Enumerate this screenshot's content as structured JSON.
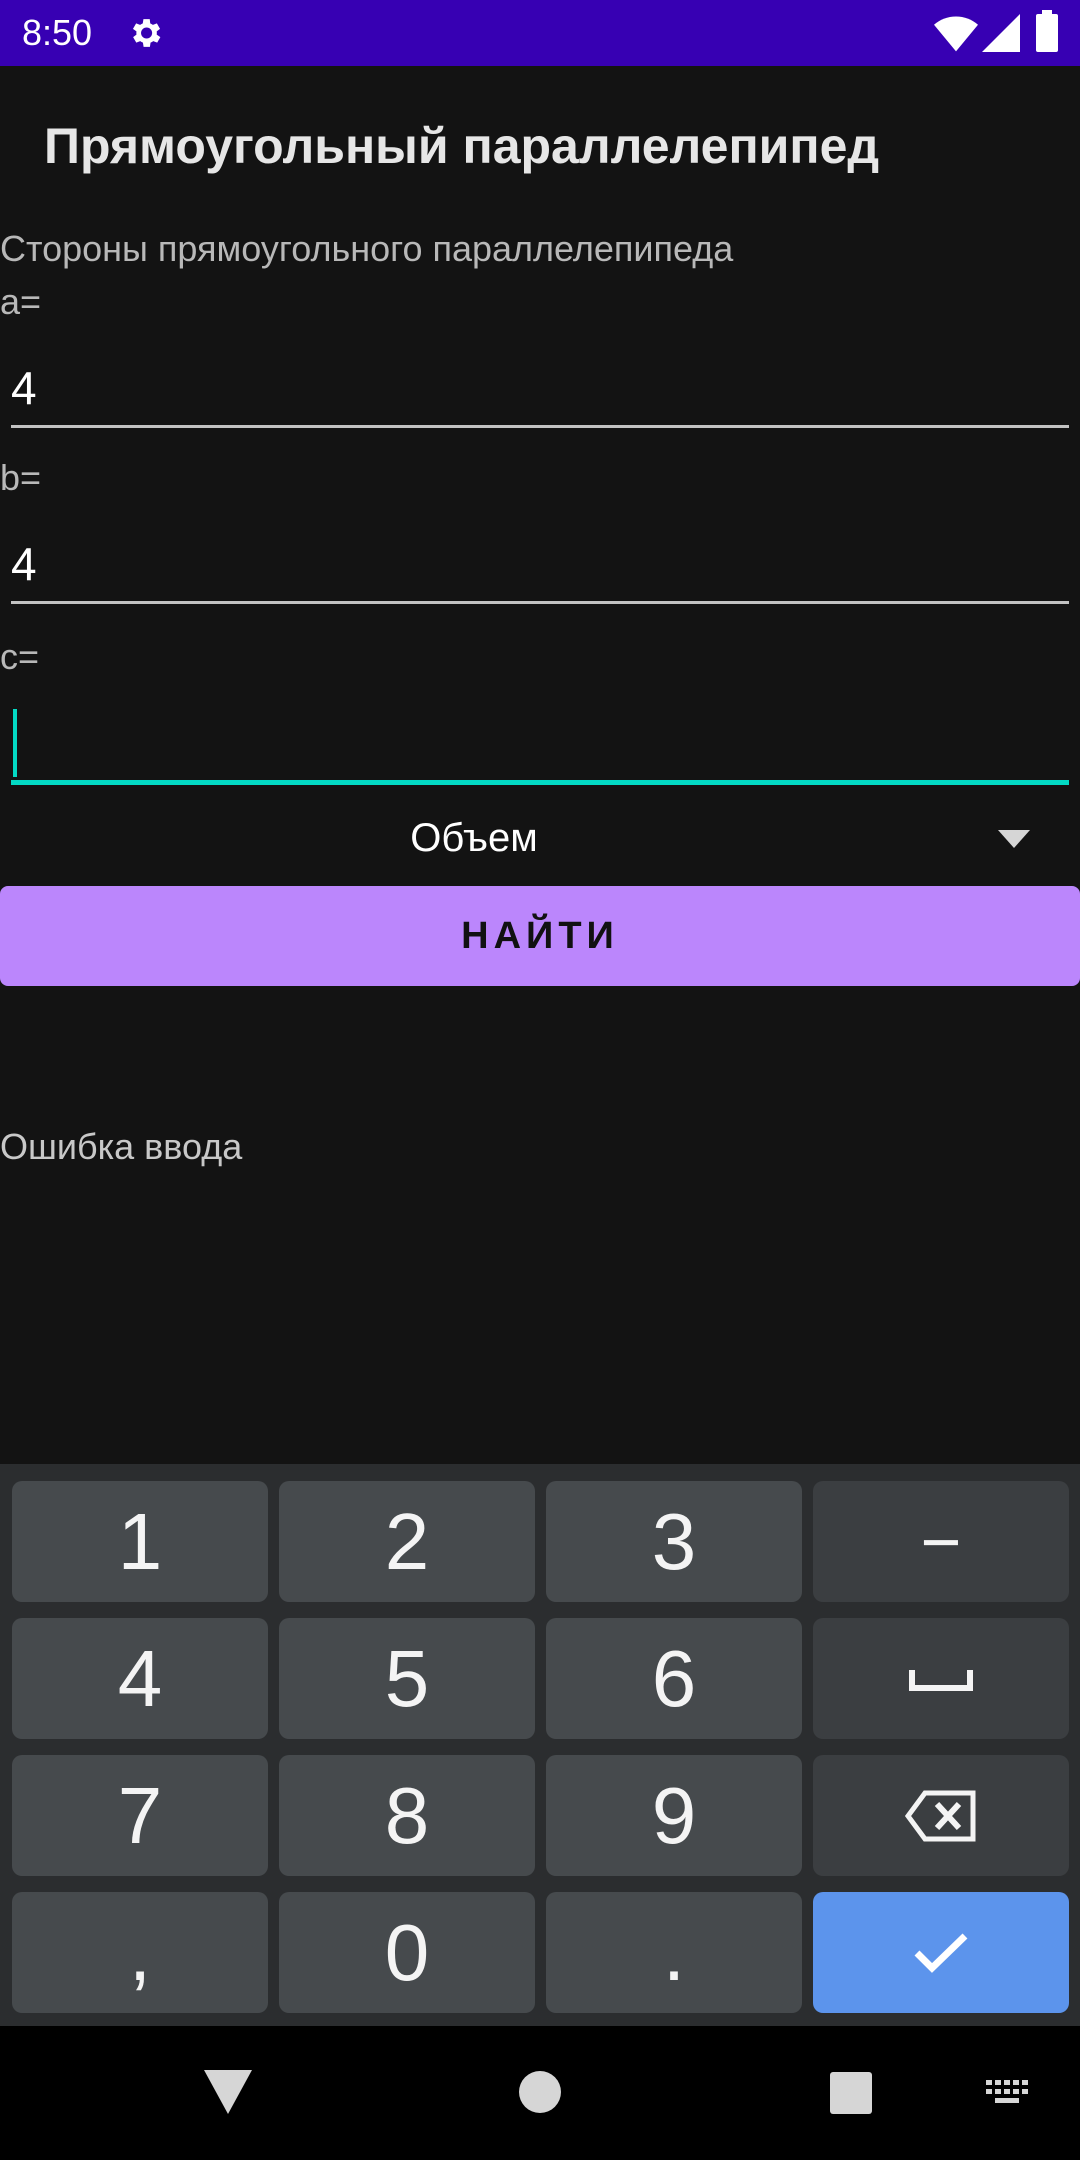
{
  "status_bar": {
    "time": "8:50",
    "icons": [
      "gear-icon",
      "wifi-icon",
      "signal-icon",
      "battery-icon"
    ]
  },
  "app": {
    "title": "Прямоугольный параллелепипед"
  },
  "form": {
    "sides_label": "Стороны прямоугольного параллелепипеда",
    "a_label": "a=",
    "a_value": "4",
    "b_label": "b=",
    "b_value": "4",
    "c_label": "c=",
    "c_value": "",
    "spinner_value": "Объем",
    "find_button": "НАЙТИ",
    "error_text": "Ошибка ввода"
  },
  "keyboard": {
    "keys": [
      "1",
      "2",
      "3",
      "−",
      "4",
      "5",
      "6",
      "␣",
      "7",
      "8",
      "9",
      "⌫",
      ",",
      "0",
      ".",
      "✓"
    ]
  },
  "colors": {
    "status_bar": "#3700b3",
    "accent": "#03dac5",
    "button": "#bb86fc",
    "enter_key": "#5c94ec",
    "background": "#131313"
  },
  "nav": {
    "icons": [
      "back-icon",
      "home-icon",
      "recents-icon",
      "keyboard-switch-icon"
    ]
  }
}
